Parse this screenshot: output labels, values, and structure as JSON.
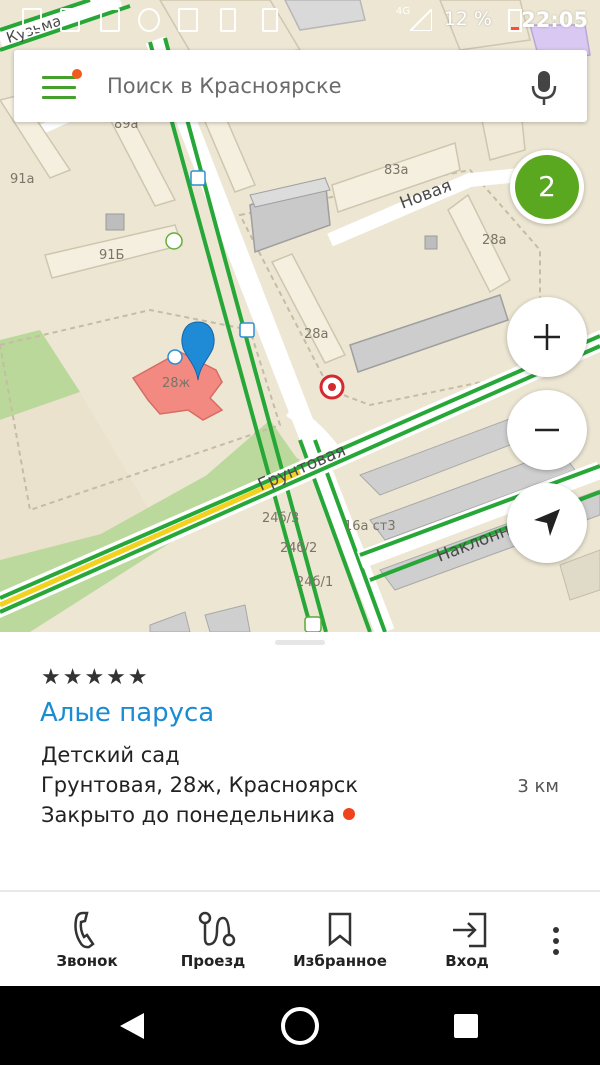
{
  "status_bar": {
    "network": "4G",
    "battery": "12 %",
    "time": "22:05"
  },
  "search": {
    "placeholder": "Поиск в Красноярске"
  },
  "map": {
    "cluster_count": "2",
    "streets": {
      "novaya": "Новая",
      "gruntovaya": "Грунтовая",
      "naklonnaya": "Наклонна",
      "top_street": "Кузьма"
    },
    "house_numbers": [
      "89а",
      "91а",
      "91Б",
      "83а",
      "28а",
      "28а",
      "28ж",
      "24б/3",
      "24б/2",
      "24б/1",
      "16а ст3"
    ]
  },
  "card": {
    "rating_stars": "★★★★★",
    "title": "Алые паруса",
    "category": "Детский сад",
    "address": "Грунтовая, 28ж, Красноярск",
    "distance": "3 км",
    "hours": "Закрыто до понедельника"
  },
  "actions": [
    {
      "label": "Звонок",
      "icon": "phone-icon"
    },
    {
      "label": "Проезд",
      "icon": "route-icon"
    },
    {
      "label": "Избранное",
      "icon": "bookmark-icon"
    },
    {
      "label": "Вход",
      "icon": "entrance-icon"
    }
  ],
  "colors": {
    "accent_green": "#45a02d",
    "link_blue": "#1b8bd3",
    "closed_dot": "#f0431d",
    "road_green": "#27a738",
    "road_yellow": "#f3d21f"
  }
}
